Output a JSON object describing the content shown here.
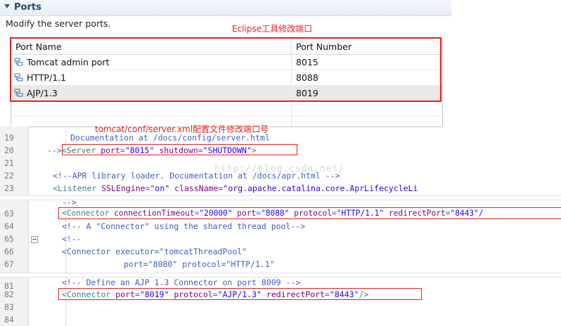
{
  "ports_section": {
    "title": "Ports",
    "description": "Modify the server ports.",
    "annotation": "Eclipse工具修改端口",
    "table": {
      "columns": [
        "Port Name",
        "Port Number"
      ],
      "rows": [
        {
          "name": "Tomcat admin port",
          "number": "8015",
          "icon": "server-port-icon"
        },
        {
          "name": "HTTP/1.1",
          "number": "8088",
          "icon": "server-port-icon"
        },
        {
          "name": "AJP/1.3",
          "number": "8019",
          "icon": "server-port-icon"
        }
      ]
    }
  },
  "code_section": {
    "annotation": "tomcat/conf/server.xml配置文件修改端口号",
    "watermark": "http://blog.csdn.net/",
    "lines": [
      {
        "n": "19",
        "text": "Documentation at /docs/config/server.html"
      },
      {
        "n": "20",
        "prefix": "-->",
        "tag_open": "<Server",
        "attr1": "port",
        "val1": "\"8015\"",
        "attr2": "shutdown",
        "val2": "\"SHUTDOWN\"",
        "tag_close": ">"
      },
      {
        "n": "21",
        "text": ""
      },
      {
        "n": "22",
        "text": "<!--APR library loader. Documentation at /docs/apr.html -->"
      },
      {
        "n": "23",
        "tag_open": "<Listener",
        "attr1": "SSLEngine",
        "val1": "\"on\"",
        "attr2": "className",
        "val2": "\"org.apache.catalina.core.AprLifecycleLi"
      },
      {
        "n": "",
        "text": "-->"
      },
      {
        "n": "63",
        "tag_open": "<Connector",
        "attr1": "connectionTimeout",
        "val1": "\"20000\"",
        "attr2": "port",
        "val2": "\"8088\"",
        "attr3": "protocol",
        "val3": "\"HTTP/1.1\"",
        "attr4": "redirectPort",
        "val4": "\"8443\"/"
      },
      {
        "n": "64",
        "text": "<!-- A \"Connector\" using the shared thread pool-->"
      },
      {
        "n": "65",
        "text": "<!--"
      },
      {
        "n": "66",
        "tag_open": "<Connector",
        "attr1": "executor",
        "val1": "\"tomcatThreadPool\""
      },
      {
        "n": "67",
        "attr1": "port",
        "val1": "\"8080\"",
        "attr2": "protocol",
        "val2": "\"HTTP/1.1\""
      },
      {
        "n": "81",
        "text": "<!-- Define an AJP 1.3 Connector on port 8009 -->"
      },
      {
        "n": "82",
        "tag_open": "<Connector",
        "attr1": "port",
        "val1": "\"8019\"",
        "attr2": "protocol",
        "val2": "\"AJP/1.3\"",
        "attr3": "redirectPort",
        "val3": "\"8443\"",
        "tag_close": "/>"
      },
      {
        "n": "83",
        "text": ""
      },
      {
        "n": "84",
        "text": ""
      }
    ]
  },
  "colors": {
    "annotation_red": "#e8201e",
    "xml_tag": "#3f7f7f",
    "xml_attr": "#7f007f",
    "xml_value": "#2a00ff",
    "xml_comment": "#3f5fbf",
    "section_title": "#25466e"
  }
}
